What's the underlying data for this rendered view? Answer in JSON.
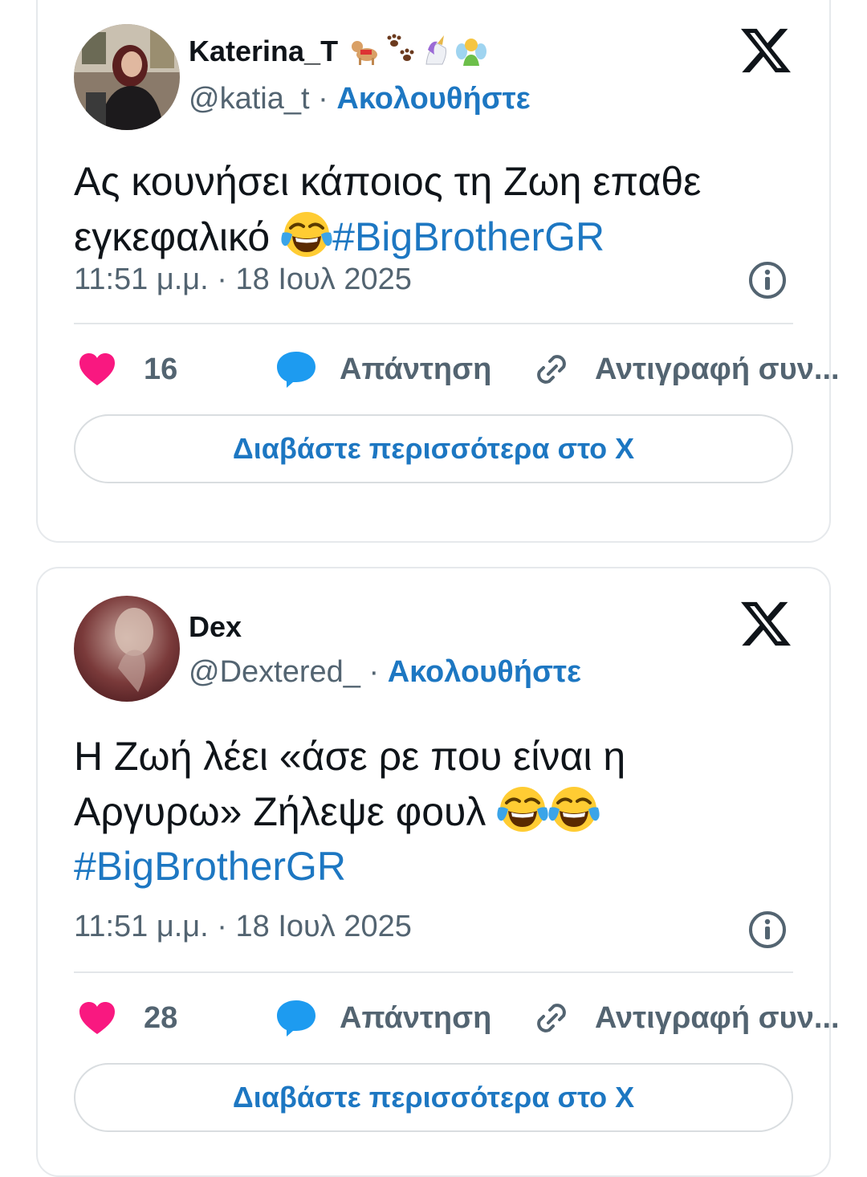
{
  "tweets": [
    {
      "name": "Katerina_T",
      "name_emojis": [
        "🐕‍🦺",
        "🐾",
        "🦄",
        "🧚‍♂️"
      ],
      "handle": "@katia_t",
      "separator": " · ",
      "follow_label": "Ακολουθήστε",
      "text_line1": "Ας κουνήσει κάποιος τη Ζωη επαθε",
      "text_line2": "εγκεφαλικό",
      "hashtag": "#BigBrotherGR",
      "timestamp": "11:51 μ.μ. · 18 Ιουλ 2025",
      "likes": "16",
      "reply_label": "Απάντηση",
      "copy_label": "Αντιγραφή συν...",
      "read_more": "Διαβάστε περισσότερα στο X"
    },
    {
      "name": "Dex",
      "handle": "@Dextered_",
      "separator": " · ",
      "follow_label": "Ακολουθήστε",
      "text_line1": "Η Ζωή λέει «άσε ρε που είναι η",
      "text_line2": "Αργυρω» Ζήλεψε φουλ",
      "hashtag": "#BigBrotherGR",
      "timestamp": "11:51 μ.μ. · 18 Ιουλ 2025",
      "likes": "28",
      "reply_label": "Απάντηση",
      "copy_label": "Αντιγραφή συν...",
      "read_more": "Διαβάστε περισσότερα στο X"
    }
  ],
  "colors": {
    "link_blue": "#1d77c2",
    "heart_pink": "#f91880",
    "reply_blue": "#1d9bf0",
    "muted_gray": "#536471",
    "border": "#e6e9ec"
  },
  "icons": {
    "brand": "x-logo-icon",
    "like": "heart-icon",
    "reply": "speech-bubble-icon",
    "copy": "link-icon",
    "info": "info-icon",
    "emoji": "tears-of-joy-emoji"
  }
}
